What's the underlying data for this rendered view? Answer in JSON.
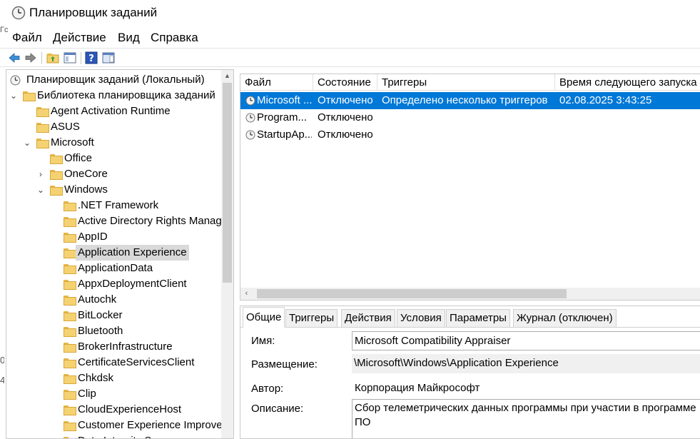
{
  "window": {
    "title": "Планировщик заданий"
  },
  "menu": [
    "Файл",
    "Действие",
    "Вид",
    "Справка"
  ],
  "tree": {
    "root": "Планировщик заданий (Локальный)",
    "library": "Библиотека планировщика заданий",
    "items": [
      "Agent Activation Runtime",
      "ASUS",
      "Microsoft",
      "Office",
      "OneCore",
      "Windows",
      ".NET Framework",
      "Active Directory Rights Manag",
      "AppID",
      "Application Experience",
      "ApplicationData",
      "AppxDeploymentClient",
      "Autochk",
      "BitLocker",
      "Bluetooth",
      "BrokerInfrastructure",
      "CertificateServicesClient",
      "Chkdsk",
      "Clip",
      "CloudExperienceHost",
      "Customer Experience Improve",
      "Data Integrity Scan"
    ]
  },
  "task_list": {
    "columns": [
      "Файл",
      "Состояние",
      "Триггеры",
      "Время следующего запуска"
    ],
    "rows": [
      {
        "name": "Microsoft ...",
        "state": "Отключено",
        "triggers": "Определено несколько триггеров",
        "next_run": "02.08.2025 3:43:25"
      },
      {
        "name": "Program...",
        "state": "Отключено",
        "triggers": "",
        "next_run": ""
      },
      {
        "name": "StartupAp...",
        "state": "Отключено",
        "triggers": "",
        "next_run": ""
      }
    ]
  },
  "details": {
    "tabs": [
      "Общие",
      "Триггеры",
      "Действия",
      "Условия",
      "Параметры",
      "Журнал (отключен)"
    ],
    "labels": {
      "name": "Имя:",
      "location": "Размещение:",
      "author": "Автор:",
      "description": "Описание:"
    },
    "values": {
      "name": "Microsoft Compatibility Appraiser",
      "location": "\\Microsoft\\Windows\\Application Experience",
      "author": "Корпорация Майкрософт",
      "description": "Сбор телеметрических данных программы при участии в программе ПО"
    }
  },
  "edge_fragments": [
    "Гс",
    "0",
    "4"
  ],
  "colors": {
    "selection": "#0078d7",
    "folder": "#f5d271"
  }
}
